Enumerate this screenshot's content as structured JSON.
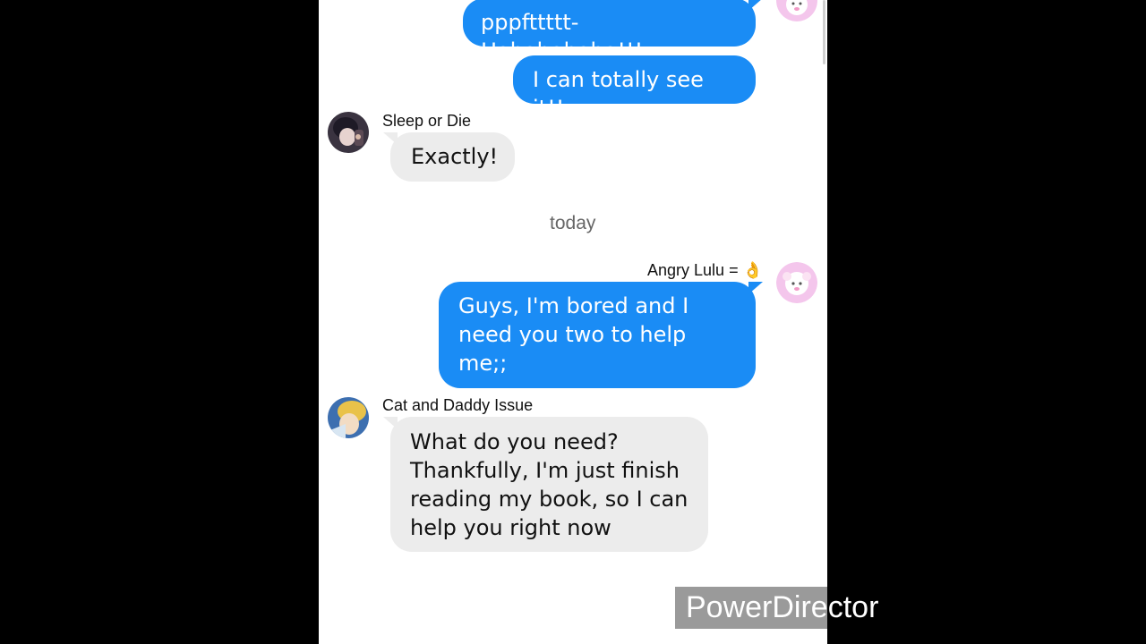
{
  "messages": [
    {
      "sender": "",
      "text": "pppfttttt-Hahahahaha!!!"
    },
    {
      "sender": "",
      "text": "I can totally see it!!"
    },
    {
      "sender": "Sleep or Die",
      "text": "Exactly!"
    },
    {
      "sender": "Angry Lulu = 👌",
      "text": "Guys, I'm bored and I need you two to help me;;"
    },
    {
      "sender": "Cat and Daddy Issue",
      "text": "What do you need? Thankfully, I'm just finish reading my book, so I can help you right now"
    }
  ],
  "date_separator": "today",
  "watermark": "PowerDirector",
  "colors": {
    "outgoing_bubble": "#1a8cf5",
    "incoming_bubble": "#ececec",
    "background": "#ffffff"
  }
}
